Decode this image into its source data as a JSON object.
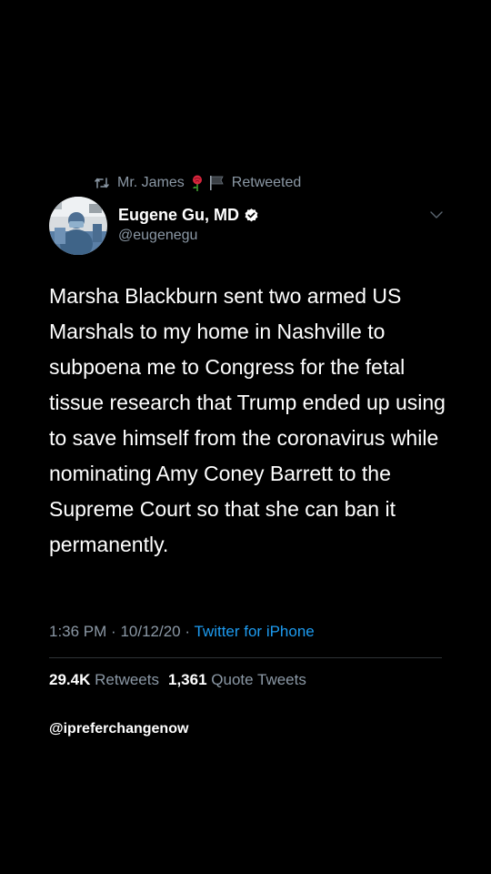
{
  "retweet": {
    "icon": "retweet-icon",
    "retweeter": "Mr. James",
    "emoji": [
      "rose-icon",
      "black-flag-icon"
    ],
    "label": "Retweeted"
  },
  "author": {
    "name": "Eugene Gu, MD",
    "handle": "@eugenegu",
    "verified": true,
    "avatar": "avatar-photo"
  },
  "tweet": {
    "text": "Marsha Blackburn sent two armed US Marshals to my home in Nashville to subpoena me to Congress for the fetal tissue research that Trump ended up using to save himself from the coronavirus while nominating Amy Coney Barrett to the Supreme Court so that she can ban it permanently."
  },
  "meta": {
    "time": "1:36 PM",
    "date": "10/12/20",
    "separator": "·",
    "source": "Twitter for iPhone"
  },
  "stats": {
    "retweets_count": "29.4K",
    "retweets_label": "Retweets",
    "quotes_count": "1,361",
    "quotes_label": "Quote Tweets"
  },
  "watermark": "@ipreferchangenow",
  "colors": {
    "background": "#000000",
    "text": "#ffffff",
    "secondary": "#8b98a5",
    "accent": "#1d9bf0",
    "divider": "#2f3336"
  }
}
